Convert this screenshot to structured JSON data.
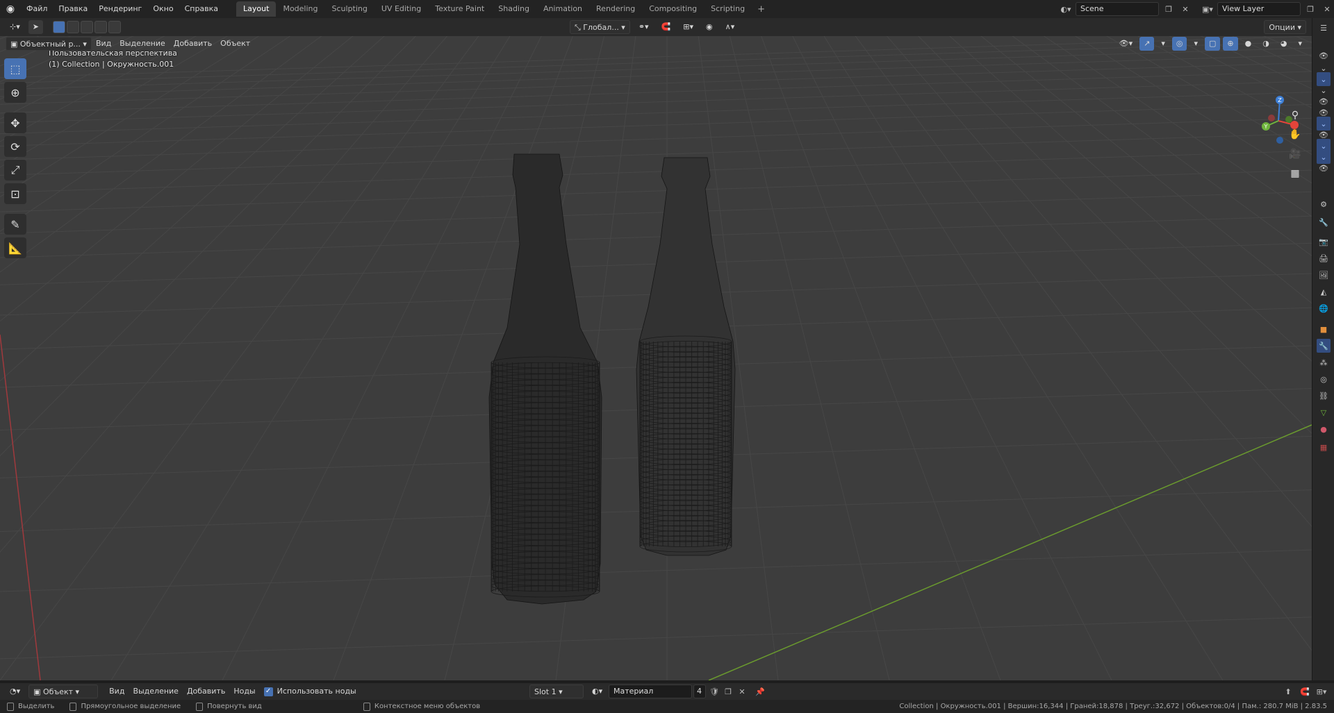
{
  "menu": {
    "items": [
      "Файл",
      "Правка",
      "Рендеринг",
      "Окно",
      "Справка"
    ]
  },
  "workspaces": {
    "tabs": [
      "Layout",
      "Modeling",
      "Sculpting",
      "UV Editing",
      "Texture Paint",
      "Shading",
      "Animation",
      "Rendering",
      "Compositing",
      "Scripting"
    ],
    "active": "Layout",
    "add_label": "+"
  },
  "scene": {
    "name": "Scene"
  },
  "view_layer": {
    "name": "View Layer"
  },
  "tool_header": {
    "transform_orientation": "Глобал...",
    "options_label": "Опции"
  },
  "view_header": {
    "mode": "Объектный р...",
    "menus": [
      "Вид",
      "Выделение",
      "Добавить",
      "Объект"
    ]
  },
  "viewport": {
    "perspective_label": "Пользовательская перспектива",
    "collection_label": "(1) Collection | Окружность.001",
    "gizmo": {
      "x_color": "#e5443a",
      "y_color": "#6fb53c",
      "z_color": "#3d7fd6"
    },
    "axis_colors": {
      "x": "#a0393d",
      "y": "#6a9a2e"
    }
  },
  "toolbar": {
    "tools": [
      "select-box-tool",
      "cursor-tool",
      "move-tool",
      "rotate-tool",
      "scale-tool",
      "transform-tool",
      "annotate-tool",
      "measure-tool"
    ]
  },
  "shader_header": {
    "object_mode": "Объект",
    "menus": [
      "Вид",
      "Выделение",
      "Добавить",
      "Ноды"
    ],
    "use_nodes_label": "Использовать ноды",
    "slot": "Slot 1",
    "material": "Материал",
    "users": "4"
  },
  "status_bar": {
    "select": "Выделить",
    "box_select": "Прямоугольное выделение",
    "rotate_view": "Повернуть вид",
    "context_menu": "Контекстное меню объектов",
    "stats": "Collection | Окружность.001 | Вершин:16,344 | Граней:18,878 | Треуг.:32,672 | Объектов:0/4 | Пам.: 280.7 MiB | 2.83.5"
  }
}
